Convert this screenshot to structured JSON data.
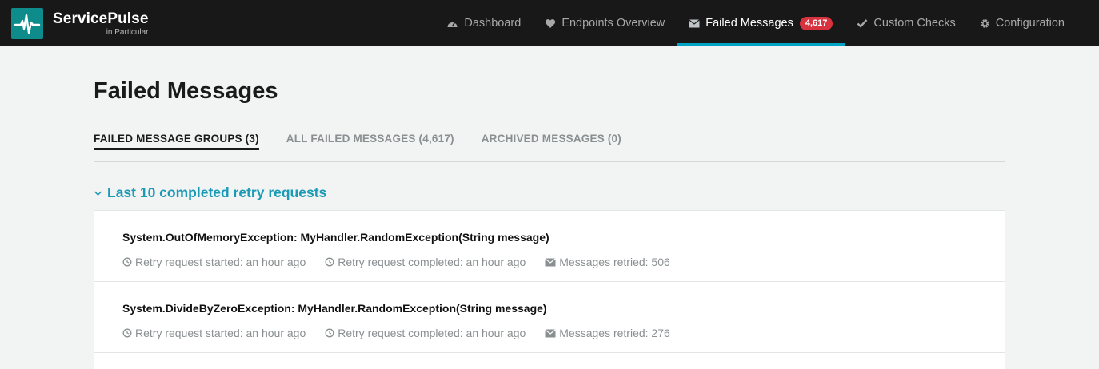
{
  "brand": {
    "name": "ServicePulse",
    "sub": "in Particular",
    "logo_icon": "pulse-icon"
  },
  "nav": [
    {
      "label": "Dashboard",
      "icon": "dashboard-icon"
    },
    {
      "label": "Endpoints Overview",
      "icon": "heart-icon"
    },
    {
      "label": "Failed Messages",
      "icon": "envelope-icon",
      "badge": "4,617",
      "active": true
    },
    {
      "label": "Custom Checks",
      "icon": "check-icon"
    },
    {
      "label": "Configuration",
      "icon": "gear-icon"
    }
  ],
  "page": {
    "title": "Failed Messages"
  },
  "tabs": [
    {
      "label": "FAILED MESSAGE GROUPS (3)",
      "active": true
    },
    {
      "label": "ALL FAILED MESSAGES (4,617)"
    },
    {
      "label": "ARCHIVED MESSAGES (0)"
    }
  ],
  "group": {
    "title": "Last 10 completed retry requests"
  },
  "retries": [
    {
      "title": "System.OutOfMemoryException: MyHandler.RandomException(String message)",
      "started": "Retry request started: an hour ago",
      "completed": "Retry request completed: an hour ago",
      "retried": "Messages retried: 506"
    },
    {
      "title": "System.DivideByZeroException: MyHandler.RandomException(String message)",
      "started": "Retry request started: an hour ago",
      "completed": "Retry request completed: an hour ago",
      "retried": "Messages retried: 276"
    }
  ],
  "colors": {
    "topbar": "#181818",
    "accent": "#00a3c4",
    "badge": "#d8323e",
    "group_title": "#1b9ab6"
  }
}
